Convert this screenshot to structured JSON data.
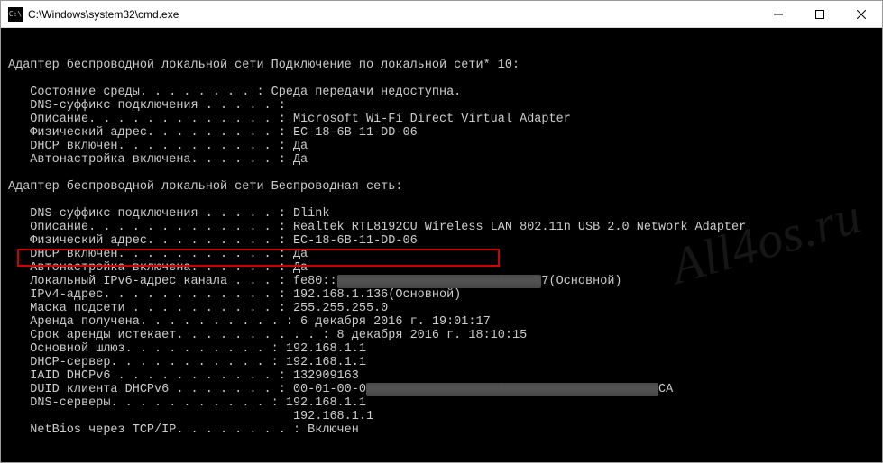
{
  "window": {
    "title": "C:\\Windows\\system32\\cmd.exe",
    "icon_label": "C:\\"
  },
  "watermark": "All4os.ru",
  "terminal": {
    "adapter1_header": "Адаптер беспроводной локальной сети Подключение по локальной сети* 10:",
    "adapter1": {
      "state": "   Состояние среды. . . . . . . . : Среда передачи недоступна.",
      "dns_suffix": "   DNS-суффикс подключения . . . . . :",
      "desc": "   Описание. . . . . . . . . . . . . : Microsoft Wi-Fi Direct Virtual Adapter",
      "phys": "   Физический адрес. . . . . . . . . : EC-18-6B-11-DD-06",
      "dhcp": "   DHCP включен. . . . . . . . . . . : Да",
      "autoconf": "   Автонастройка включена. . . . . . : Да"
    },
    "adapter2_header": "Адаптер беспроводной локальной сети Беспроводная сеть:",
    "adapter2": {
      "dns_suffix": "   DNS-суффикс подключения . . . . . : Dlink",
      "desc": "   Описание. . . . . . . . . . . . . : Realtek RTL8192CU Wireless LAN 802.11n USB 2.0 Network Adapter",
      "phys": "   Физический адрес. . . . . . . . . : EC-18-6B-11-DD-06",
      "dhcp": "   DHCP включен. . . . . . . . . . . : Да",
      "autoconf": "   Автонастройка включена. . . . . . : Да",
      "ipv6_pref": "   Локальный IPv6-адрес канала . . . : fe80::",
      "ipv6_hidden": "xxxxxxxxxxxxxxxxxxxxxxxxxxxx",
      "ipv6_suf": "7(Основной)",
      "ipv4": "   IPv4-адрес. . . . . . . . . . . . : 192.168.1.136(Основной)",
      "mask": "   Маска подсети . . . . . . . . . . : 255.255.255.0",
      "lease_ob": "   Аренда получена. . . . . . . . . . : 6 декабря 2016 г. 19:01:17",
      "lease_ex": "   Срок аренды истекает. . . . . . . . . . : 8 декабря 2016 г. 18:10:15",
      "gateway": "   Основной шлюз. . . . . . . . . . : 192.168.1.1",
      "dhcp_srv": "   DHCP-сервер. . . . . . . . . . . : 192.168.1.1",
      "iaid": "   IAID DHCPv6 . . . . . . . . . . . : 132909163",
      "duid_pref": "   DUID клиента DHCPv6 . . . . . . . : 00-01-00-0",
      "duid_hidden": "xxxxxxxxxxxxxxxxxxxxxxxxxxxxxxxxxxxxxxxx",
      "duid_suf": "CA",
      "dns1": "   DNS-серверы. . . . . . . . . . . : 192.168.1.1",
      "dns2": "                                       192.168.1.1",
      "netbios": "   NetBios через TCP/IP. . . . . . . . : Включен"
    }
  }
}
